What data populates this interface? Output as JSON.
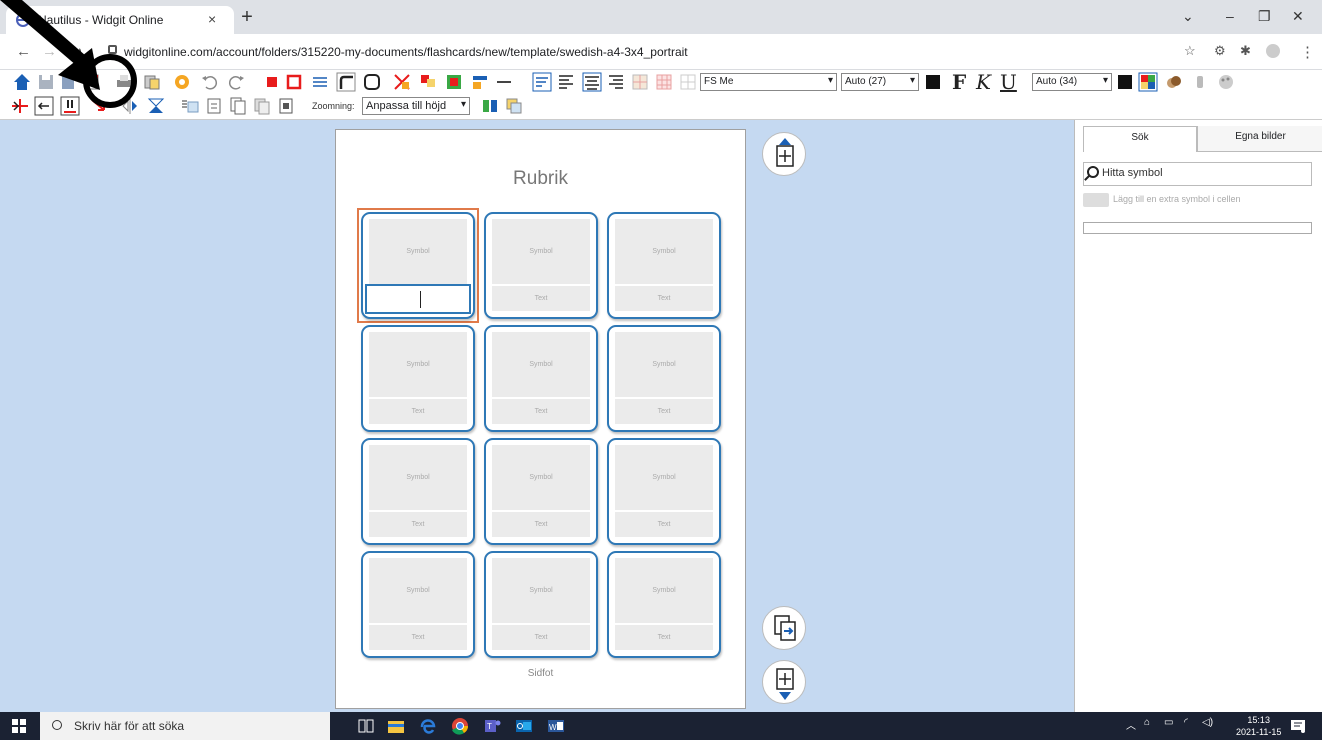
{
  "browser": {
    "tab_title": "Nautilus - Widgit Online",
    "close_symbol": "×",
    "new_tab_symbol": "+",
    "url": "widgitonline.com/account/folders/315220-my-documents/flashcards/new/template/swedish-a4-3x4_portrait"
  },
  "toolbar": {
    "font": "FS Me",
    "font_size": "Auto (27)",
    "bold_label": "F",
    "italic_label": "K",
    "underline_label": "U",
    "line_size": "Auto (34)",
    "zoom_label": "Zoomning:",
    "zoom_value": "Anpassa till höjd",
    "colors": {
      "red": "#e81c1c",
      "black": "#111111",
      "orange": "#f5a623",
      "blue": "#1a5fb4"
    }
  },
  "document": {
    "title": "Rubrik",
    "footer": "Sidfot",
    "symbol_placeholder": "Symbol",
    "text_placeholder": "Text"
  },
  "panel": {
    "tab_search": "Sök",
    "tab_own_images": "Egna bilder",
    "search_placeholder": "Hitta symbol",
    "add_symbol_label": "Lägg till en extra symbol i cellen"
  },
  "taskbar": {
    "search_placeholder": "Skriv här för att söka",
    "time": "15:13",
    "date": "2021-11-15"
  },
  "annotation": {
    "shape": "arrow pointing at circled toolbar button",
    "color": "#000000"
  }
}
